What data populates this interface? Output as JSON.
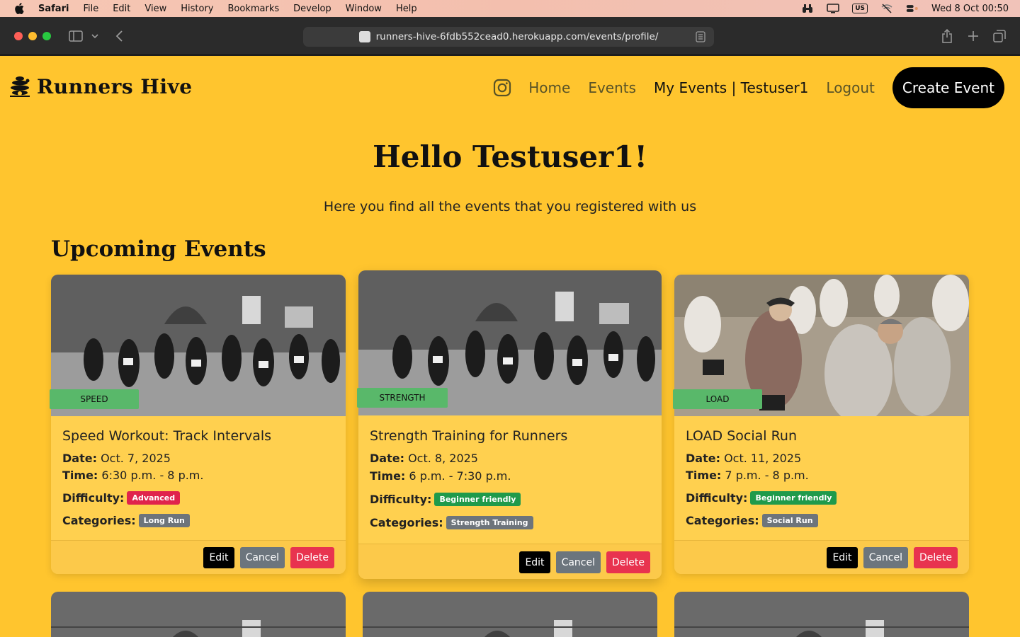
{
  "menubar": {
    "app": "Safari",
    "items": [
      "File",
      "Edit",
      "View",
      "History",
      "Bookmarks",
      "Develop",
      "Window",
      "Help"
    ],
    "input_source": "US",
    "clock": "Wed 8 Oct  00:50"
  },
  "browser": {
    "url": "runners-hive-6fdb552cead0.herokuapp.com/events/profile/"
  },
  "nav": {
    "brand": "Runners Hive",
    "links": [
      "Home",
      "Events",
      "My Events | Testuser1",
      "Logout"
    ],
    "create_button": "Create Event"
  },
  "hero": {
    "title": "Hello Testuser1!",
    "subtitle": "Here you find all the events that you registered with us"
  },
  "section_title": "Upcoming Events",
  "labels": {
    "date": "Date:",
    "time": "Time:",
    "difficulty": "Difficulty:",
    "categories": "Categories:"
  },
  "buttons": {
    "edit": "Edit",
    "cancel": "Cancel",
    "delete": "Delete"
  },
  "events": [
    {
      "badge": "SPEED",
      "title": "Speed Workout: Track Intervals",
      "date": "Oct. 7, 2025",
      "time": "6:30 p.m. - 8 p.m.",
      "difficulty": "Advanced",
      "category": "Long Run"
    },
    {
      "badge": "STRENGTH",
      "title": "Strength Training for Runners",
      "date": "Oct. 8, 2025",
      "time": "6 p.m. - 7:30 p.m.",
      "difficulty": "Beginner friendly",
      "category": "Strength Training"
    },
    {
      "badge": "LOAD",
      "title": "LOAD Social Run",
      "date": "Oct. 11, 2025",
      "time": "7 p.m. - 8 p.m.",
      "difficulty": "Beginner friendly",
      "category": "Social Run"
    }
  ],
  "colors": {
    "page_bg": "#ffc52e",
    "card_bg": "#ffd04f",
    "badge_green": "#59b86a",
    "advanced": "#e0234c",
    "beginner": "#1f9a4b",
    "category": "#6d747b"
  }
}
